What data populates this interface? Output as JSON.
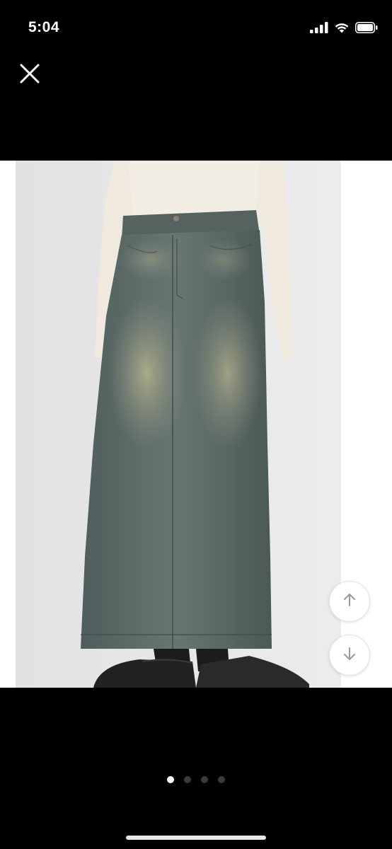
{
  "status_bar": {
    "time": "5:04",
    "icons": [
      "cellular-signal-icon",
      "wifi-icon",
      "battery-icon"
    ]
  },
  "viewer": {
    "close_icon": "close-icon",
    "image_subject": "product-photo",
    "scroll_up_icon": "arrow-up-icon",
    "scroll_down_icon": "arrow-down-icon",
    "page_count": 4,
    "current_page": 1
  },
  "colors": {
    "background": "#000000",
    "denim": "#5f6d6a",
    "sweater": "#efe9de",
    "button_bg": "#ffffff",
    "arrow": "#9a9a9a"
  }
}
